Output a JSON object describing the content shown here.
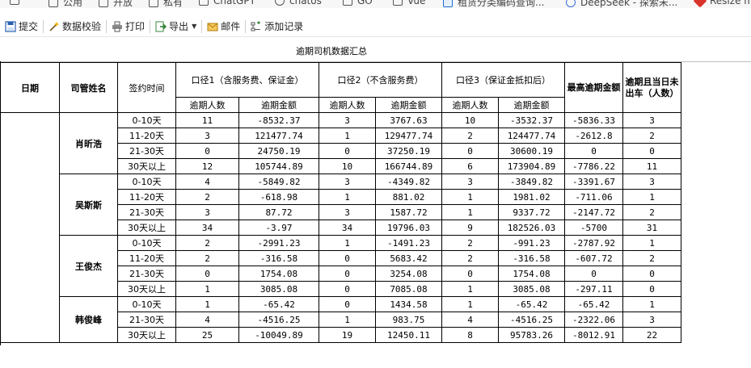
{
  "bookmarks": [
    {
      "label": "公用",
      "icon": "folder-icon"
    },
    {
      "label": "开放",
      "icon": "folder-icon"
    },
    {
      "label": "私有",
      "icon": "folder-icon"
    },
    {
      "label": "ChatGPT",
      "icon": "folder-icon"
    },
    {
      "label": "chatos",
      "icon": "folder-icon"
    },
    {
      "label": "GO",
      "icon": "folder-icon"
    },
    {
      "label": "Vue",
      "icon": "folder-icon"
    },
    {
      "label": "租赁分类编码查询...",
      "icon": "site-icon"
    },
    {
      "label": "DeepSeek - 探索未...",
      "icon": "deepseek-icon"
    },
    {
      "label": "Resize m...",
      "icon": "resize-icon"
    }
  ],
  "toolbar": {
    "submit": "提交",
    "validate": "数据校验",
    "print": "打印",
    "export": "导出",
    "mail": "邮件",
    "add_record": "添加记录"
  },
  "report": {
    "title": "逾期司机数据汇总",
    "headers": {
      "date": "日期",
      "manager": "司管姓名",
      "sign_time": "签约时间",
      "caliber1": "口径1（含服务费、保证金）",
      "caliber2": "口径2（不含服务费）",
      "caliber3": "口径3（保证金抵扣后）",
      "max_overdue": "最高逾期金额",
      "overdue_not_out": "逾期且当日未出车（人数）",
      "count": "逾期人数",
      "amount": "逾期金额"
    },
    "groups": [
      {
        "name": "肖昕浩",
        "rows": [
          {
            "period": "0-10天",
            "c1n": "11",
            "c1a": "-8532.37",
            "c2n": "3",
            "c2a": "3767.63",
            "c3n": "10",
            "c3a": "-3532.37",
            "max": "-5836.33",
            "idle": "3"
          },
          {
            "period": "11-20天",
            "c1n": "3",
            "c1a": "121477.74",
            "c2n": "1",
            "c2a": "129477.74",
            "c3n": "2",
            "c3a": "124477.74",
            "max": "-2612.8",
            "idle": "2"
          },
          {
            "period": "21-30天",
            "c1n": "0",
            "c1a": "24750.19",
            "c2n": "0",
            "c2a": "37250.19",
            "c3n": "0",
            "c3a": "30600.19",
            "max": "0",
            "idle": "0"
          },
          {
            "period": "30天以上",
            "c1n": "12",
            "c1a": "105744.89",
            "c2n": "10",
            "c2a": "166744.89",
            "c3n": "6",
            "c3a": "173904.89",
            "max": "-7786.22",
            "idle": "11"
          }
        ]
      },
      {
        "name": "吴斯斯",
        "rows": [
          {
            "period": "0-10天",
            "c1n": "4",
            "c1a": "-5849.82",
            "c2n": "3",
            "c2a": "-4349.82",
            "c3n": "3",
            "c3a": "-3849.82",
            "max": "-3391.67",
            "idle": "3"
          },
          {
            "period": "11-20天",
            "c1n": "2",
            "c1a": "-618.98",
            "c2n": "1",
            "c2a": "881.02",
            "c3n": "1",
            "c3a": "1981.02",
            "max": "-711.06",
            "idle": "1"
          },
          {
            "period": "21-30天",
            "c1n": "3",
            "c1a": "87.72",
            "c2n": "3",
            "c2a": "1587.72",
            "c3n": "1",
            "c3a": "9337.72",
            "max": "-2147.72",
            "idle": "2"
          },
          {
            "period": "30天以上",
            "c1n": "34",
            "c1a": "-3.97",
            "c2n": "34",
            "c2a": "19796.03",
            "c3n": "9",
            "c3a": "182526.03",
            "max": "-5700",
            "idle": "31"
          }
        ]
      },
      {
        "name": "王俊杰",
        "rows": [
          {
            "period": "0-10天",
            "c1n": "2",
            "c1a": "-2991.23",
            "c2n": "1",
            "c2a": "-1491.23",
            "c3n": "2",
            "c3a": "-991.23",
            "max": "-2787.92",
            "idle": "1"
          },
          {
            "period": "11-20天",
            "c1n": "2",
            "c1a": "-316.58",
            "c2n": "0",
            "c2a": "5683.42",
            "c3n": "2",
            "c3a": "-316.58",
            "max": "-607.72",
            "idle": "2"
          },
          {
            "period": "21-30天",
            "c1n": "0",
            "c1a": "1754.08",
            "c2n": "0",
            "c2a": "3254.08",
            "c3n": "0",
            "c3a": "1754.08",
            "max": "0",
            "idle": "0"
          },
          {
            "period": "30天以上",
            "c1n": "1",
            "c1a": "3085.08",
            "c2n": "0",
            "c2a": "7085.08",
            "c3n": "1",
            "c3a": "3085.08",
            "max": "-297.11",
            "idle": "0"
          }
        ]
      },
      {
        "name": "韩俊峰",
        "rows": [
          {
            "period": "0-10天",
            "c1n": "1",
            "c1a": "-65.42",
            "c2n": "0",
            "c2a": "1434.58",
            "c3n": "1",
            "c3a": "-65.42",
            "max": "-65.42",
            "idle": "1"
          },
          {
            "period": "21-30天",
            "c1n": "4",
            "c1a": "-4516.25",
            "c2n": "1",
            "c2a": "983.75",
            "c3n": "4",
            "c3a": "-4516.25",
            "max": "-2322.06",
            "idle": "3"
          },
          {
            "period": "30天以上",
            "c1n": "25",
            "c1a": "-10049.89",
            "c2n": "19",
            "c2a": "12450.11",
            "c3n": "8",
            "c3a": "95783.26",
            "max": "-8012.91",
            "idle": "22"
          }
        ]
      }
    ]
  }
}
